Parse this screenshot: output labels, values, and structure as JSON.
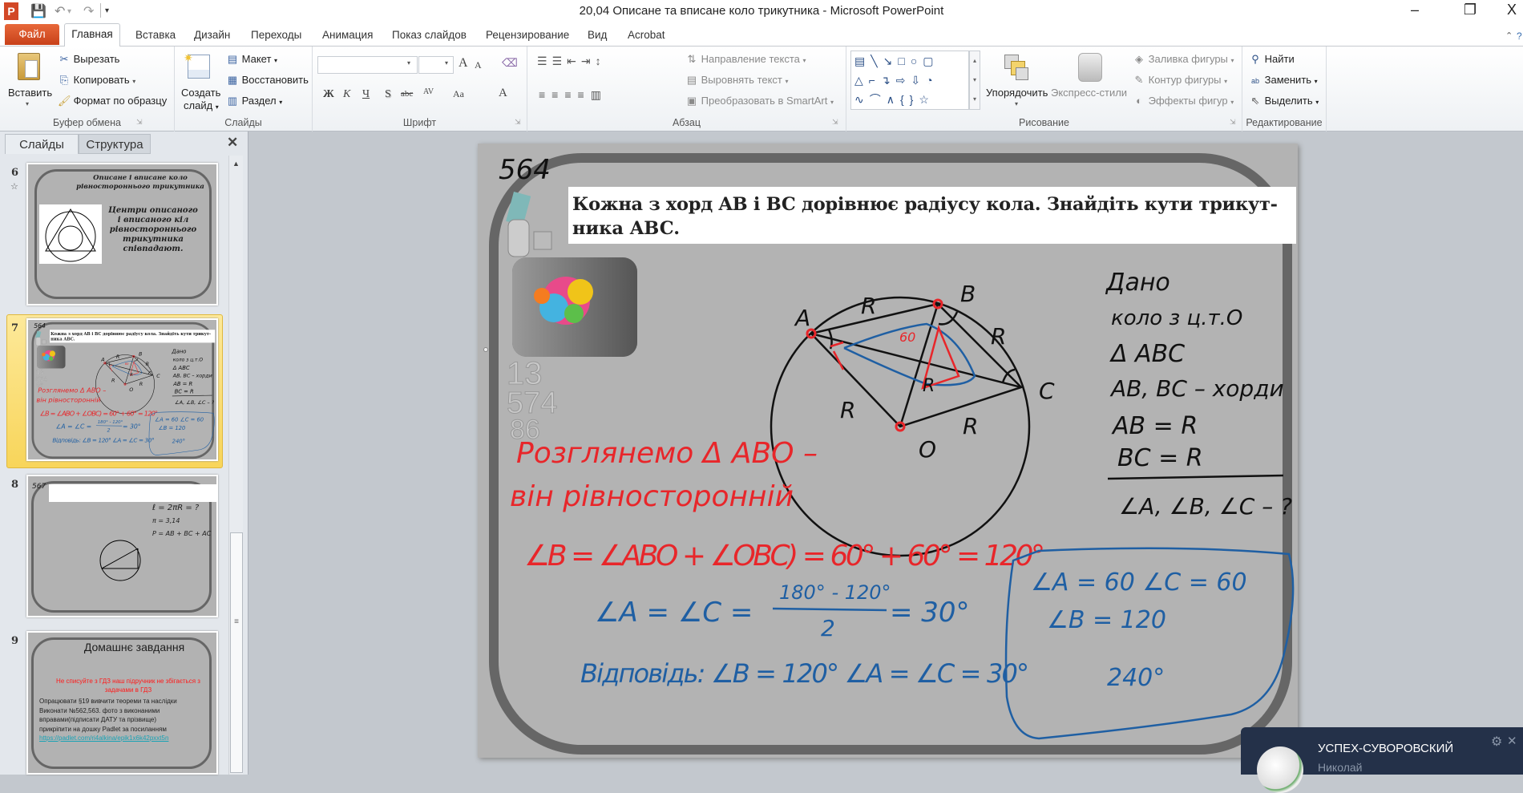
{
  "window": {
    "title": "20,04 Описане та вписане коло трикутника  -  Microsoft PowerPoint",
    "app_icon": "P",
    "controls": {
      "minimize": "–",
      "restore": "❐",
      "close": "X"
    }
  },
  "ribbon_tabs": {
    "file": "Файл",
    "items": [
      "Главная",
      "Вставка",
      "Дизайн",
      "Переходы",
      "Анимация",
      "Показ слайдов",
      "Рецензирование",
      "Вид",
      "Acrobat"
    ],
    "active": "Главная"
  },
  "ribbon": {
    "clipboard": {
      "label": "Буфер обмена",
      "paste": "Вставить",
      "cut": "Вырезать",
      "copy": "Копировать",
      "format_painter": "Формат по образцу"
    },
    "slides": {
      "label": "Слайды",
      "new_slide_1": "Создать",
      "new_slide_2": "слайд",
      "layout": "Макет",
      "reset": "Восстановить",
      "section": "Раздел"
    },
    "font": {
      "label": "Шрифт",
      "font_name": "",
      "font_size": "",
      "grow": "A",
      "shrink": "A",
      "bold": "Ж",
      "italic": "К",
      "underline": "Ч",
      "shadow": "S",
      "strike": "abc",
      "spacing": "AV",
      "case": "Aa",
      "color": "A"
    },
    "paragraph": {
      "label": "Абзац",
      "text_direction": "Направление текста",
      "align_text": "Выровнять текст",
      "smartart": "Преобразовать в SmartArt"
    },
    "drawing": {
      "label": "Рисование",
      "arrange": "Упорядочить",
      "quick_styles": "Экспресс-стили",
      "fill": "Заливка фигуры",
      "outline": "Контур фигуры",
      "effects": "Эффекты фигур"
    },
    "editing": {
      "label": "Редактирование",
      "find": "Найти",
      "replace": "Заменить",
      "select": "Выделить"
    }
  },
  "panel": {
    "tabs": [
      "Слайды",
      "Структура"
    ],
    "close": "✕",
    "slides": [
      {
        "number": "6",
        "title": "Описане і вписане коло рівностороннього трикутника",
        "body": [
          "Центри описаного",
          "і вписаного кіл",
          "рівностороннього",
          "трикутника",
          "співпадают."
        ]
      },
      {
        "number": "7"
      },
      {
        "number": "8",
        "notes": [
          "567",
          "ℓ = 2πR = ?",
          "π = 3,14",
          "P = AB + BC + AC"
        ]
      },
      {
        "number": "9",
        "title": "Домашнє завдання",
        "warning": [
          "Не списуйте з ГДЗ наш підручник не збігається з",
          "задачами  в ГДЗ"
        ],
        "body": [
          "Опрацювати §19  вивчити теореми та наслідки",
          "Виконати  №562,563. фото  з виконаними",
          "вправами(підписати ДАТУ та прізвище)",
          "прикріпити  на дошку  Padlet за посиланням"
        ],
        "link": "https://padlet.com/ri4alkina/epik1x6k42pxxt5n"
      }
    ]
  },
  "slide": {
    "problem_number": "564",
    "problem_line1": "Кожна з хорд AB і BC дорівнює радіусу кола. Знайдіть кути трикут-",
    "problem_line2": "ника ABC.",
    "points": {
      "A": "A",
      "B": "B",
      "C": "C",
      "O": "O"
    },
    "radius_label": "R",
    "angle_note": "60",
    "given": [
      "Дано",
      "коло з ц.т.О",
      "Δ ABC",
      "AB, BC – хорди",
      "AB = R",
      "BC = R",
      "∠A, ∠B, ∠C – ?"
    ],
    "red_notes": [
      "Розглянемо Δ ABO –",
      "він рівносторонній",
      "∠B = ∠ABO + ∠OBC) = 60° + 60° = 120°"
    ],
    "blue_formula": {
      "left": "∠A = ∠C =",
      "numerator": "180° - 120°",
      "denominator": "2",
      "result": "= 30°"
    },
    "answer": "Відповідь:  ∠B = 120°   ∠A = ∠C = 30°",
    "box_notes": [
      "∠A = 60   ∠C = 60",
      "∠B = 120",
      "240°"
    ],
    "colors": {
      "red": "#e8262a",
      "blue": "#1f5fa3",
      "ink": "#111111"
    }
  },
  "notification": {
    "title": "УСПЕХ-СУВОРОВСКИЙ",
    "subtitle": "Николай",
    "settings_icon": "gear-icon",
    "close": "✕"
  }
}
